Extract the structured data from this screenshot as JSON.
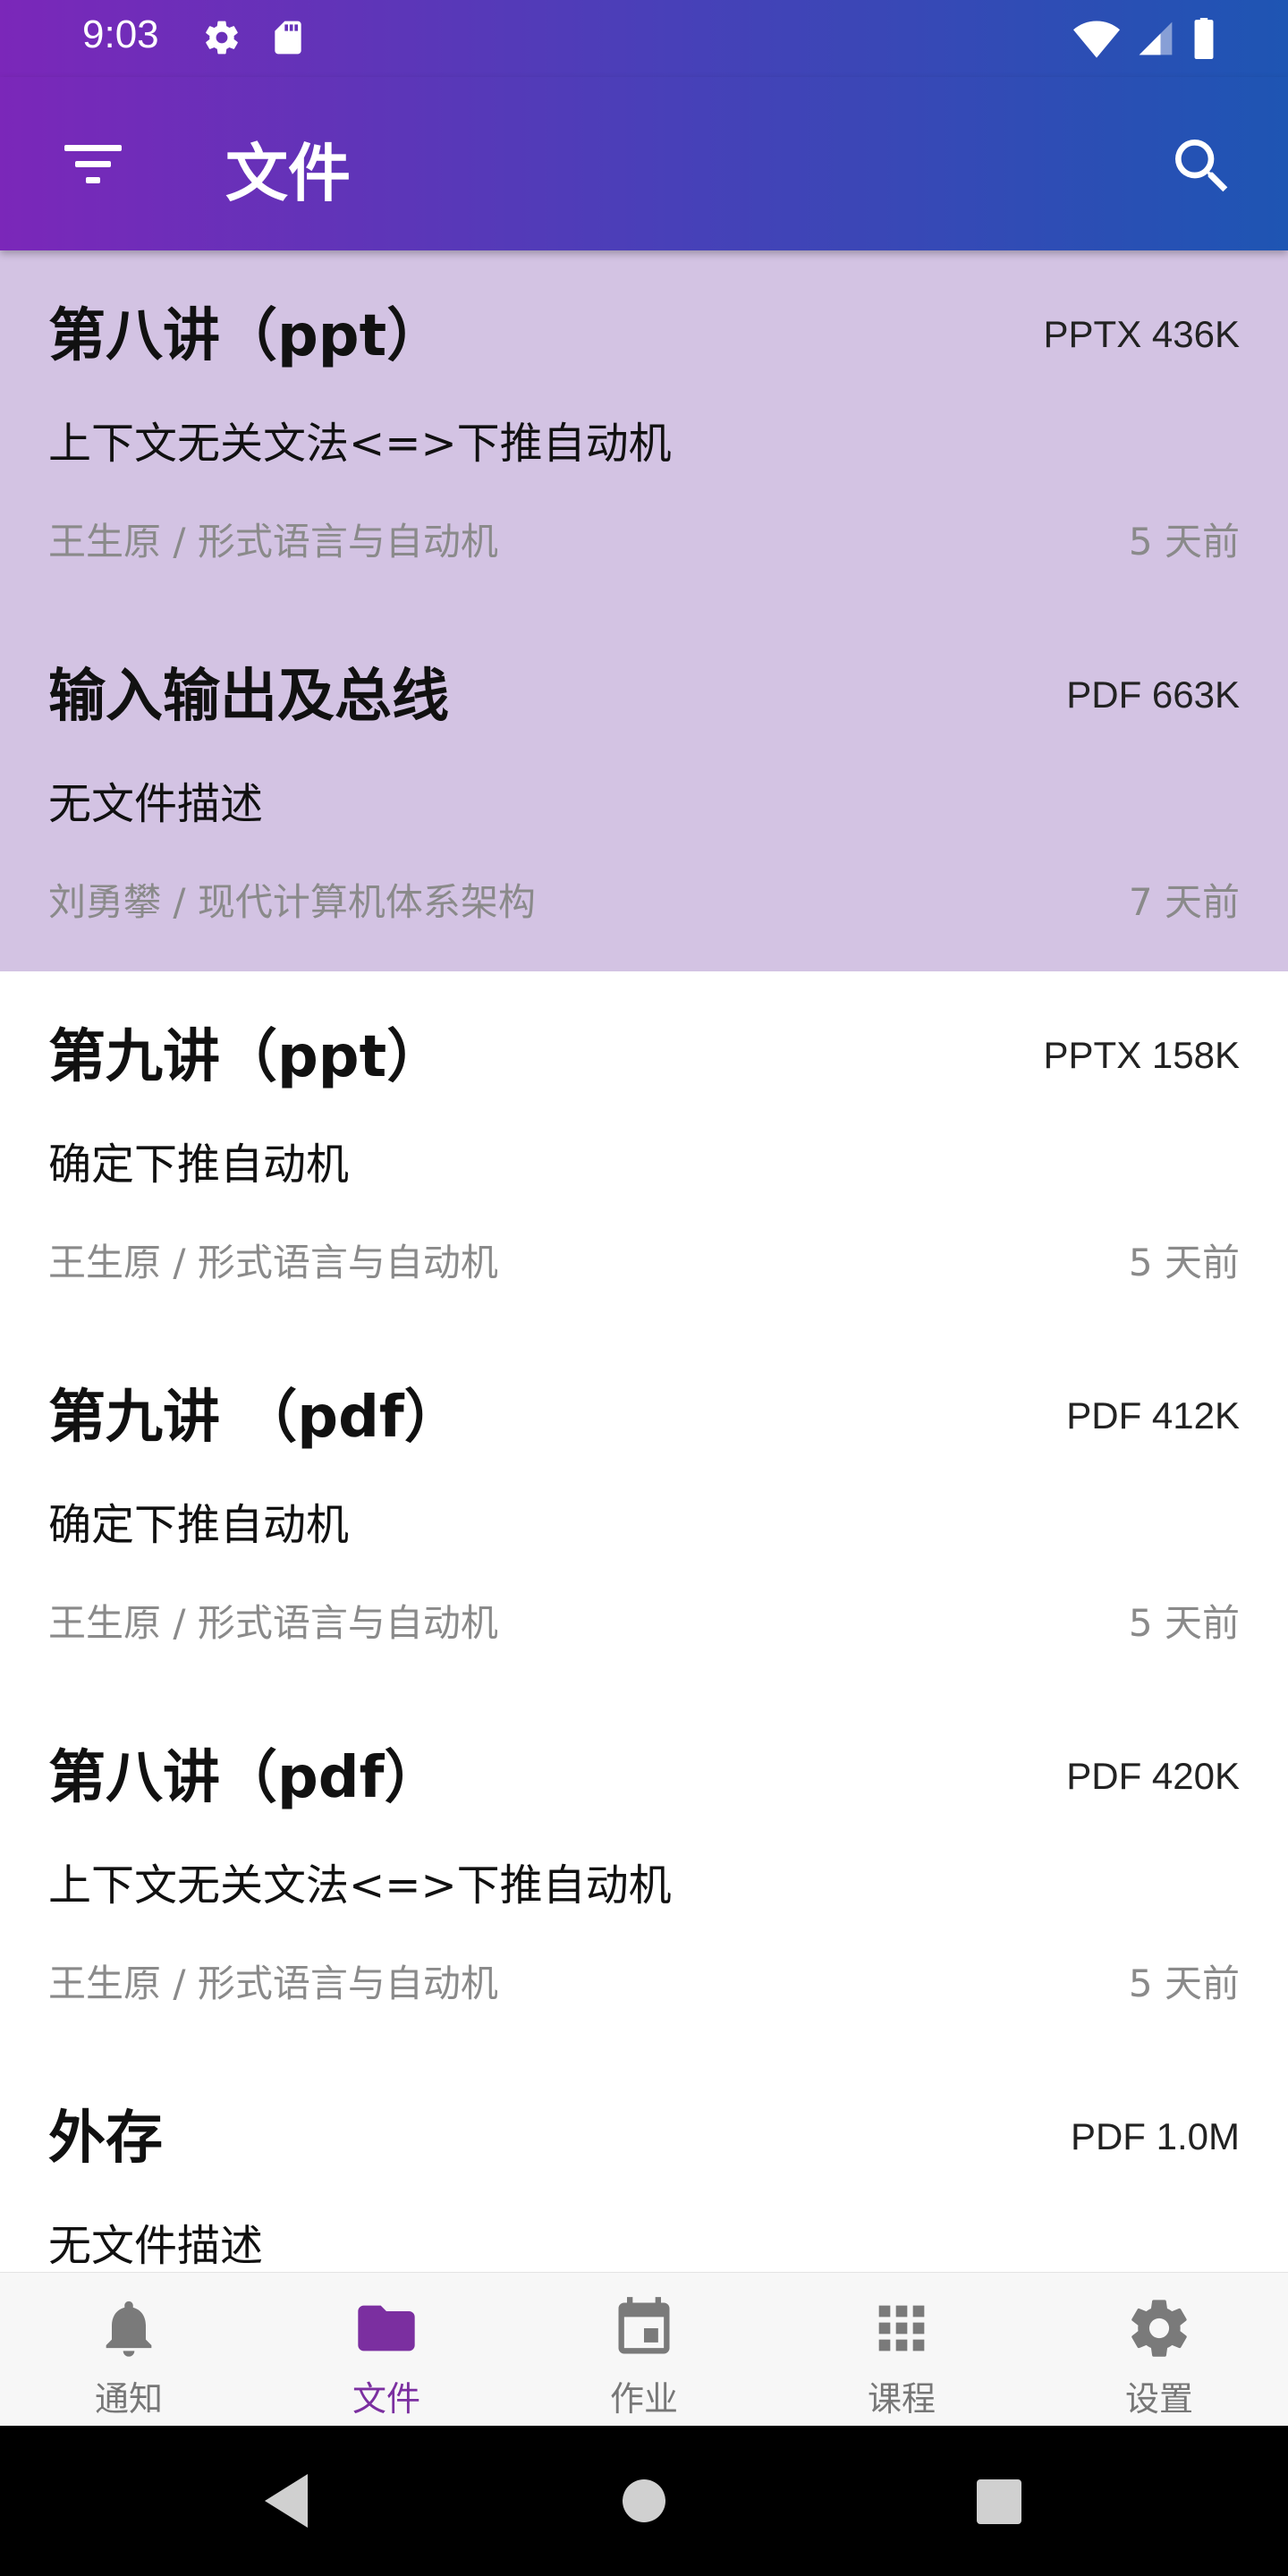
{
  "status_bar": {
    "time": "9:03"
  },
  "app_bar": {
    "title": "文件"
  },
  "files": [
    {
      "title": "第八讲（ppt）",
      "meta": "PPTX 436K",
      "description": "上下文无关文法<=>下推自动机",
      "course": "王生原 / 形式语言与自动机",
      "time": "5 天前",
      "selected": true
    },
    {
      "title": "输入输出及总线",
      "meta": "PDF 663K",
      "description": "无文件描述",
      "course": "刘勇攀 / 现代计算机体系架构",
      "time": "7 天前",
      "selected": true
    },
    {
      "title": "第九讲（ppt）",
      "meta": "PPTX 158K",
      "description": "确定下推自动机",
      "course": "王生原 / 形式语言与自动机",
      "time": "5 天前",
      "selected": false
    },
    {
      "title": "第九讲 （pdf）",
      "meta": "PDF 412K",
      "description": "确定下推自动机",
      "course": "王生原 / 形式语言与自动机",
      "time": "5 天前",
      "selected": false
    },
    {
      "title": "第八讲（pdf）",
      "meta": "PDF 420K",
      "description": "上下文无关文法<=>下推自动机",
      "course": "王生原 / 形式语言与自动机",
      "time": "5 天前",
      "selected": false
    },
    {
      "title": "外存",
      "meta": "PDF 1.0M",
      "description": "无文件描述",
      "course": "",
      "time": "",
      "selected": false
    }
  ],
  "bottom_nav": [
    {
      "label": "通知",
      "icon": "bell-icon"
    },
    {
      "label": "文件",
      "icon": "folder-icon",
      "active": true
    },
    {
      "label": "作业",
      "icon": "calendar-icon"
    },
    {
      "label": "课程",
      "icon": "grid-icon"
    },
    {
      "label": "设置",
      "icon": "gear-icon"
    }
  ],
  "colors": {
    "accent": "#7b2fa0",
    "selected_bg": "#d3c3e3",
    "header_start": "#7b27b9",
    "header_end": "#1e55b3"
  }
}
